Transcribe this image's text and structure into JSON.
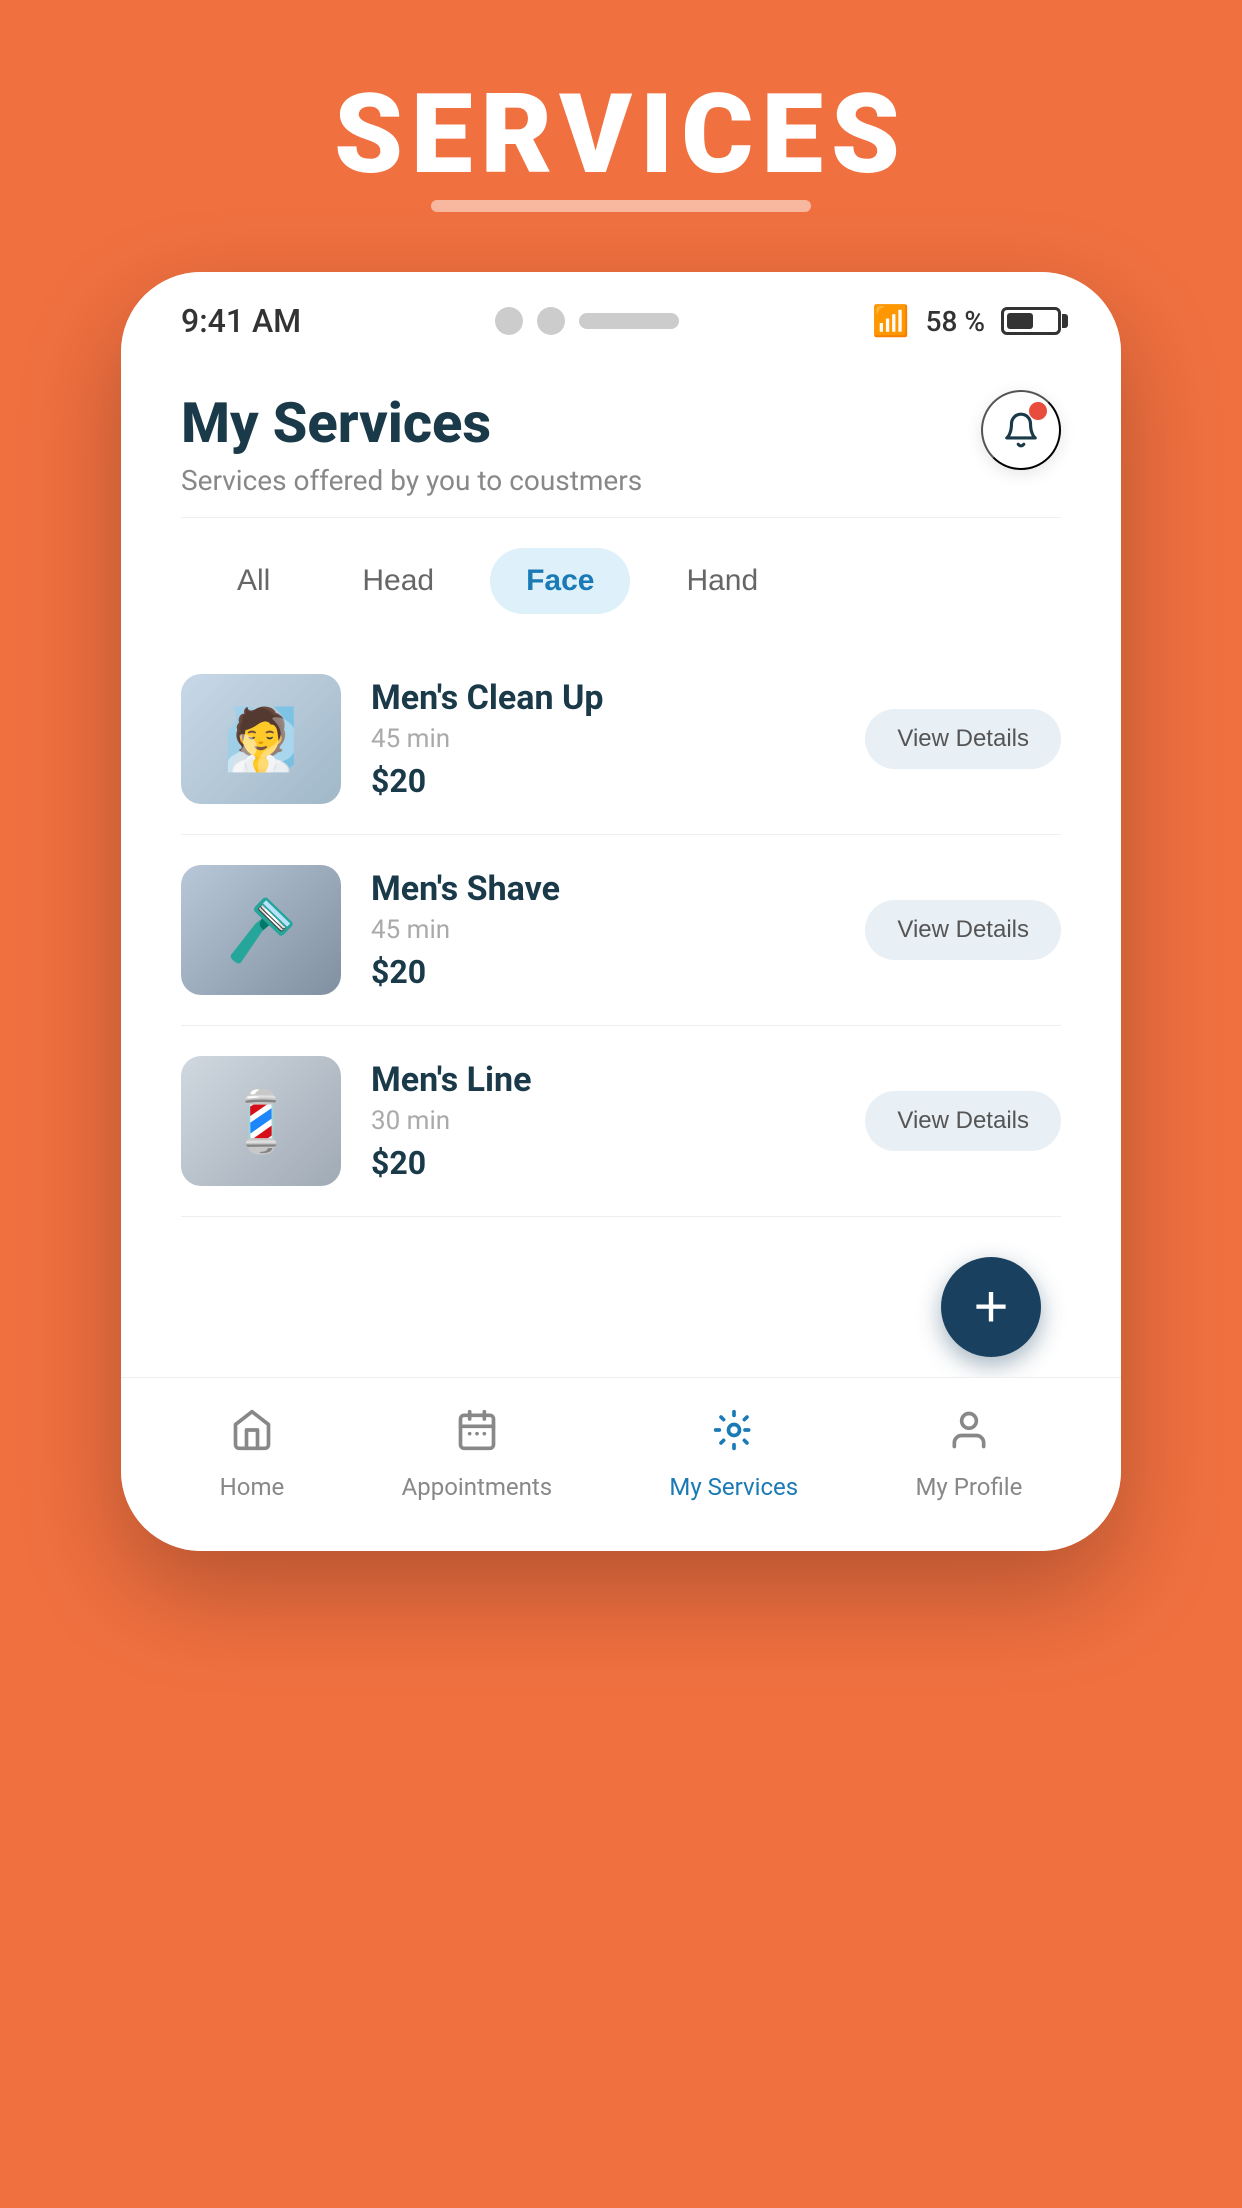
{
  "page": {
    "title": "SERVICES",
    "bg_color": "#F07040"
  },
  "status_bar": {
    "time": "9:41 AM",
    "battery_pct": "58 %"
  },
  "header": {
    "title": "My Services",
    "subtitle": "Services offered by you to coustmers",
    "bell_label": "notifications"
  },
  "filters": {
    "items": [
      {
        "label": "All",
        "active": false
      },
      {
        "label": "Head",
        "active": false
      },
      {
        "label": "Face",
        "active": true
      },
      {
        "label": "Hand",
        "active": false
      }
    ]
  },
  "services": [
    {
      "name": "Men's Clean Up",
      "duration": "45 min",
      "price": "$20",
      "btn_label": "View Details",
      "img_class": "img-cleanup",
      "icon": "🧖"
    },
    {
      "name": "Men's Shave",
      "duration": "45 min",
      "price": "$20",
      "btn_label": "View Details",
      "img_class": "img-shave",
      "icon": "🪒"
    },
    {
      "name": "Men's Line",
      "duration": "30 min",
      "price": "$20",
      "btn_label": "View Details",
      "img_class": "img-line",
      "icon": "💈"
    }
  ],
  "fab": {
    "label": "+"
  },
  "bottom_nav": {
    "items": [
      {
        "label": "Home",
        "active": false,
        "icon": "home"
      },
      {
        "label": "Appointments",
        "active": false,
        "icon": "calendar"
      },
      {
        "label": "My Services",
        "active": true,
        "icon": "services"
      },
      {
        "label": "My Profile",
        "active": false,
        "icon": "profile"
      }
    ]
  }
}
